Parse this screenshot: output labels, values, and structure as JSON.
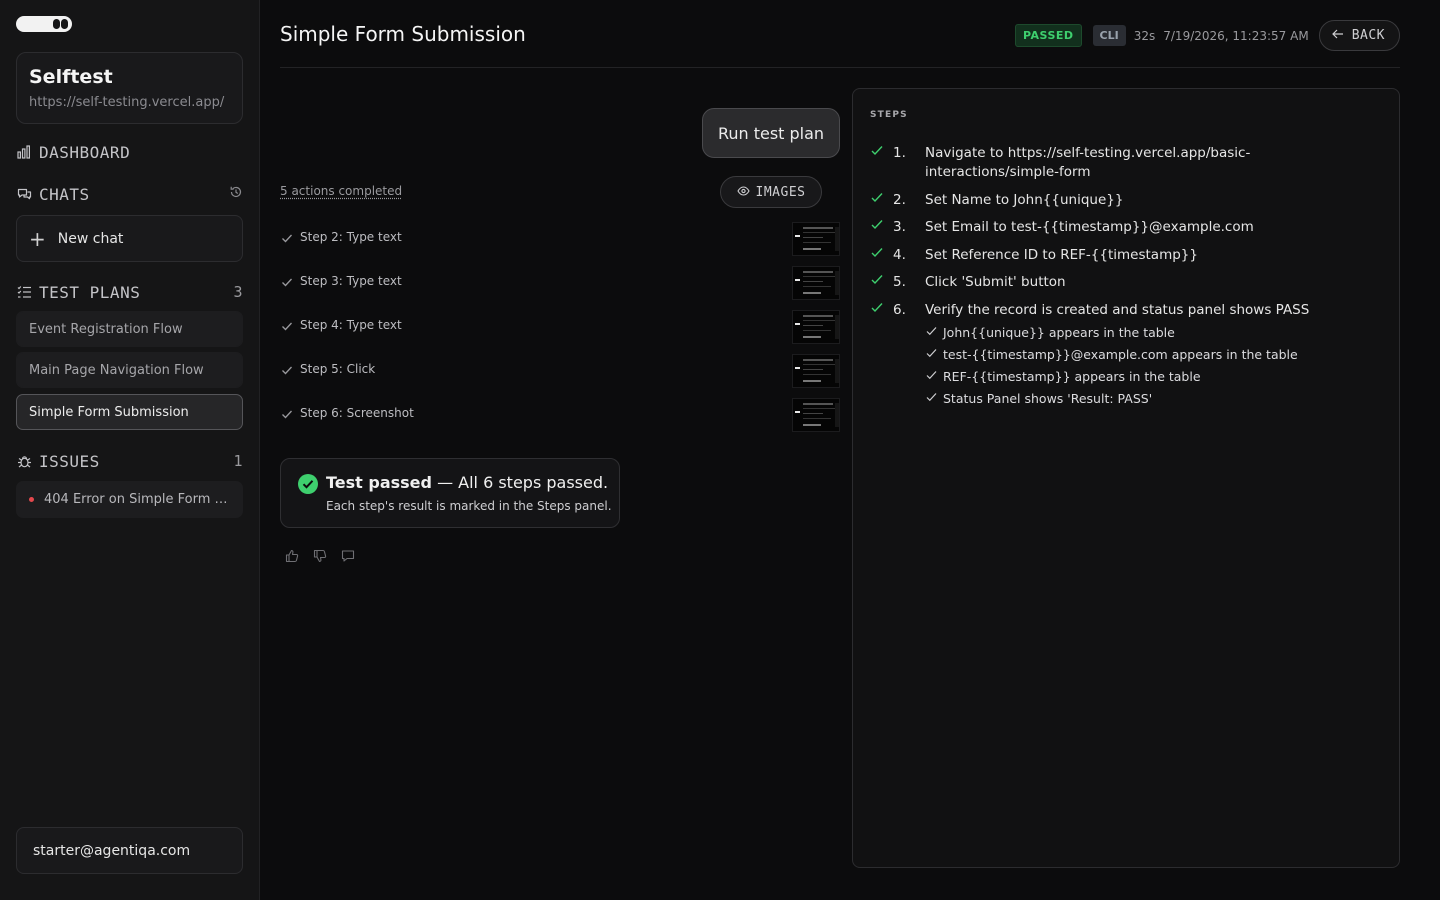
{
  "sidebar": {
    "project": {
      "name": "Selftest",
      "url": "https://self-testing.vercel.app/"
    },
    "dashboard_label": "DASHBOARD",
    "chats_label": "CHATS",
    "new_chat_label": "New chat",
    "test_plans_label": "TEST PLANS",
    "test_plans_count": "3",
    "plans": [
      {
        "label": "Event Registration Flow"
      },
      {
        "label": "Main Page Navigation Flow"
      },
      {
        "label": "Simple Form Submission"
      }
    ],
    "issues_label": "ISSUES",
    "issues_count": "1",
    "issues": [
      {
        "label": "404 Error on Simple Form p..."
      }
    ],
    "user_email": "starter@agentiqa.com"
  },
  "header": {
    "title": "Simple Form Submission",
    "status_badge": "PASSED",
    "source_badge": "CLI",
    "duration": "32s",
    "timestamp": "7/19/2026, 11:23:57 AM",
    "back_label": "BACK"
  },
  "chat": {
    "run_message": "Run test plan",
    "actions_summary": "5 actions completed",
    "images_label": "IMAGES",
    "actions": [
      {
        "label": "Step 2: Type text"
      },
      {
        "label": "Step 3: Type text"
      },
      {
        "label": "Step 4: Type text"
      },
      {
        "label": "Step 5: Click"
      },
      {
        "label": "Step 6: Screenshot"
      }
    ],
    "result": {
      "title_bold": "Test passed",
      "title_rest": " — All 6 steps passed.",
      "subtitle": "Each step's result is marked in the Steps panel."
    }
  },
  "steps_panel": {
    "heading": "STEPS",
    "steps": [
      {
        "num": "1.",
        "text": "Navigate to https://self-testing.vercel.app/basic-interactions/simple-form"
      },
      {
        "num": "2.",
        "text": "Set Name to John{{unique}}"
      },
      {
        "num": "3.",
        "text": "Set Email to test-{{timestamp}}@example.com"
      },
      {
        "num": "4.",
        "text": "Set Reference ID to REF-{{timestamp}}"
      },
      {
        "num": "5.",
        "text": "Click 'Submit' button"
      },
      {
        "num": "6.",
        "text": "Verify the record is created and status panel shows PASS"
      }
    ],
    "substeps": [
      {
        "text": "John{{unique}} appears in the table"
      },
      {
        "text": "test-{{timestamp}}@example.com appears in the table"
      },
      {
        "text": "REF-{{timestamp}} appears in the table"
      },
      {
        "text": "Status Panel shows 'Result: PASS'"
      }
    ]
  },
  "colors": {
    "background": "#0c0c0d",
    "sidebar": "#151516",
    "success": "#3ecf6e",
    "issue_dot": "#e5484d"
  },
  "icons": {
    "dashboard": "bar-chart-icon",
    "chats": "chat-bubbles-icon",
    "history": "history-icon",
    "test_plans": "checklist-icon",
    "issues": "bug-icon",
    "back": "arrow-left-icon",
    "images": "eye-icon",
    "step_status": "check-icon",
    "result": "check-circle-icon",
    "feedback": [
      "thumbs-up-icon",
      "thumbs-down-icon",
      "comment-icon"
    ]
  }
}
